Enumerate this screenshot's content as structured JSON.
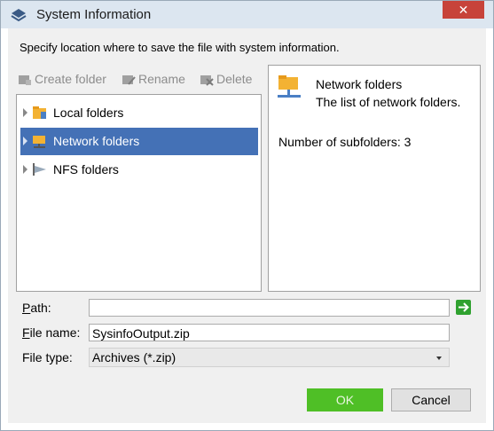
{
  "window": {
    "title": "System Information",
    "close_glyph": "✕"
  },
  "intro": "Specify location where to save the file with system information.",
  "toolbar": {
    "create": "Create folder",
    "rename": "Rename",
    "delete": "Delete"
  },
  "tree": [
    {
      "label": "Local folders",
      "icon": "local-folder-icon",
      "selected": false
    },
    {
      "label": "Network folders",
      "icon": "network-folder-icon",
      "selected": true
    },
    {
      "label": "NFS folders",
      "icon": "nfs-folder-icon",
      "selected": false
    }
  ],
  "info": {
    "title": "Network folders",
    "description": "The list of network folders.",
    "subfolders": "Number of subfolders: 3"
  },
  "form": {
    "path_label_u": "P",
    "path_label_rest": "ath:",
    "path_value": "",
    "filename_label_u": "F",
    "filename_label_rest": "ile name:",
    "filename_value": "SysinfoOutput.zip",
    "filetype_label": "File type:",
    "filetype_value": "Archives (*.zip)"
  },
  "buttons": {
    "ok": "OK",
    "cancel": "Cancel"
  },
  "colors": {
    "accent": "#4471b6",
    "ok": "#4fbf26",
    "close": "#c7433a"
  }
}
